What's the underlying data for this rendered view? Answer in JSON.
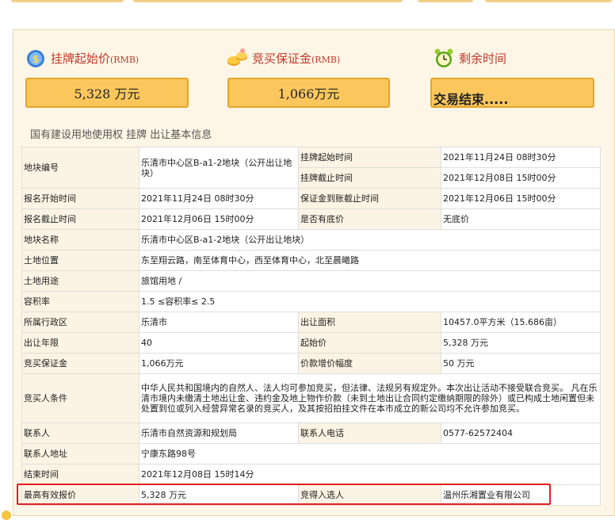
{
  "summary": {
    "start_price": {
      "label": "挂牌起始价",
      "unit_label": "(RMB)",
      "value": "5,328 万元",
      "icon": "money-bag-icon"
    },
    "deposit": {
      "label": "竞买保证金",
      "unit_label": "(RMB)",
      "value": "1,066万元",
      "icon": "coins-icon"
    },
    "time_left": {
      "label": "剩余时间",
      "value": "交易结束.....",
      "icon": "alarm-clock-icon"
    }
  },
  "section_title": "国有建设用地使用权 挂牌 出让基本信息",
  "table": {
    "parcel_no_key": "地块编号",
    "parcel_no_val": "乐清市中心区B-a1-2地块（公开出让地块）",
    "list_start_key": "挂牌起始时间",
    "list_start_val": "2021年11月24日 08时30分",
    "list_end_key": "挂牌截止时间",
    "list_end_val": "2021年12月08日 15时00分",
    "reg_start_key": "报名开始时间",
    "reg_start_val": "2021年11月24日 08时30分",
    "deposit_deadline_key": "保证金到账截止时间",
    "deposit_deadline_val": "2021年12月06日 15时00分",
    "reg_end_key": "报名截止时间",
    "reg_end_val": "2021年12月06日 15时00分",
    "reserve_key": "是否有底价",
    "reserve_val": "无底价",
    "name_key": "地块名称",
    "name_val": "乐清市中心区B-a1-2地块（公开出让地块）",
    "location_key": "土地位置",
    "location_val": "东至翔云路，南至体育中心，西至体育中心，北至晨曦路",
    "use_key": "土地用途",
    "use_val": "旅馆用地 /",
    "far_key": "容积率",
    "far_val": "1.5 ≤容积率≤ 2.5",
    "district_key": "所属行政区",
    "district_val": "乐清市",
    "area_key": "出让面积",
    "area_val": "10457.0平方米（15.686亩）",
    "term_key": "出让年限",
    "term_val": "40",
    "start_price_key": "起始价",
    "start_price_val": "5,328 万元",
    "deposit_key": "竞买保证金",
    "deposit_val": "1,066万元",
    "increment_key": "价款增价幅度",
    "increment_val": "50 万元",
    "bidder_key": "竞买人条件",
    "bidder_val": "中华人民共和国境内的自然人、法人均可参加竞买，但法律、法规另有规定外。本次出让活动不接受联合竞买。 凡在乐清市境内未缴清土地出让金、违约金及地上物作价款（未到土地出让合同约定缴纳期限的除外）或已构成土地闲置但未处置到位或列入经营异常名录的竞买人，及其按招拍挂文件在本市成立的新公司均不允许参加竞买。",
    "contact_key": "联系人",
    "contact_val": "乐清市自然资源和规划局",
    "phone_key": "联系人电话",
    "phone_val": "0577-62572404",
    "address_key": "联系人地址",
    "address_val": "宁康东路98号",
    "end_time_key": "结束时间",
    "end_time_val": "2021年12月08日 15时14分",
    "best_bid_key": "最高有效报价",
    "best_bid_val": "5,328 万元",
    "winner_key": "竞得入选人",
    "winner_val": "温州乐湘置业有限公司"
  },
  "colors": {
    "panel_bg": "#fdf6e6",
    "value_box": "#fbc75c",
    "header_text": "#c0392b",
    "highlight_border": "#e02020"
  }
}
